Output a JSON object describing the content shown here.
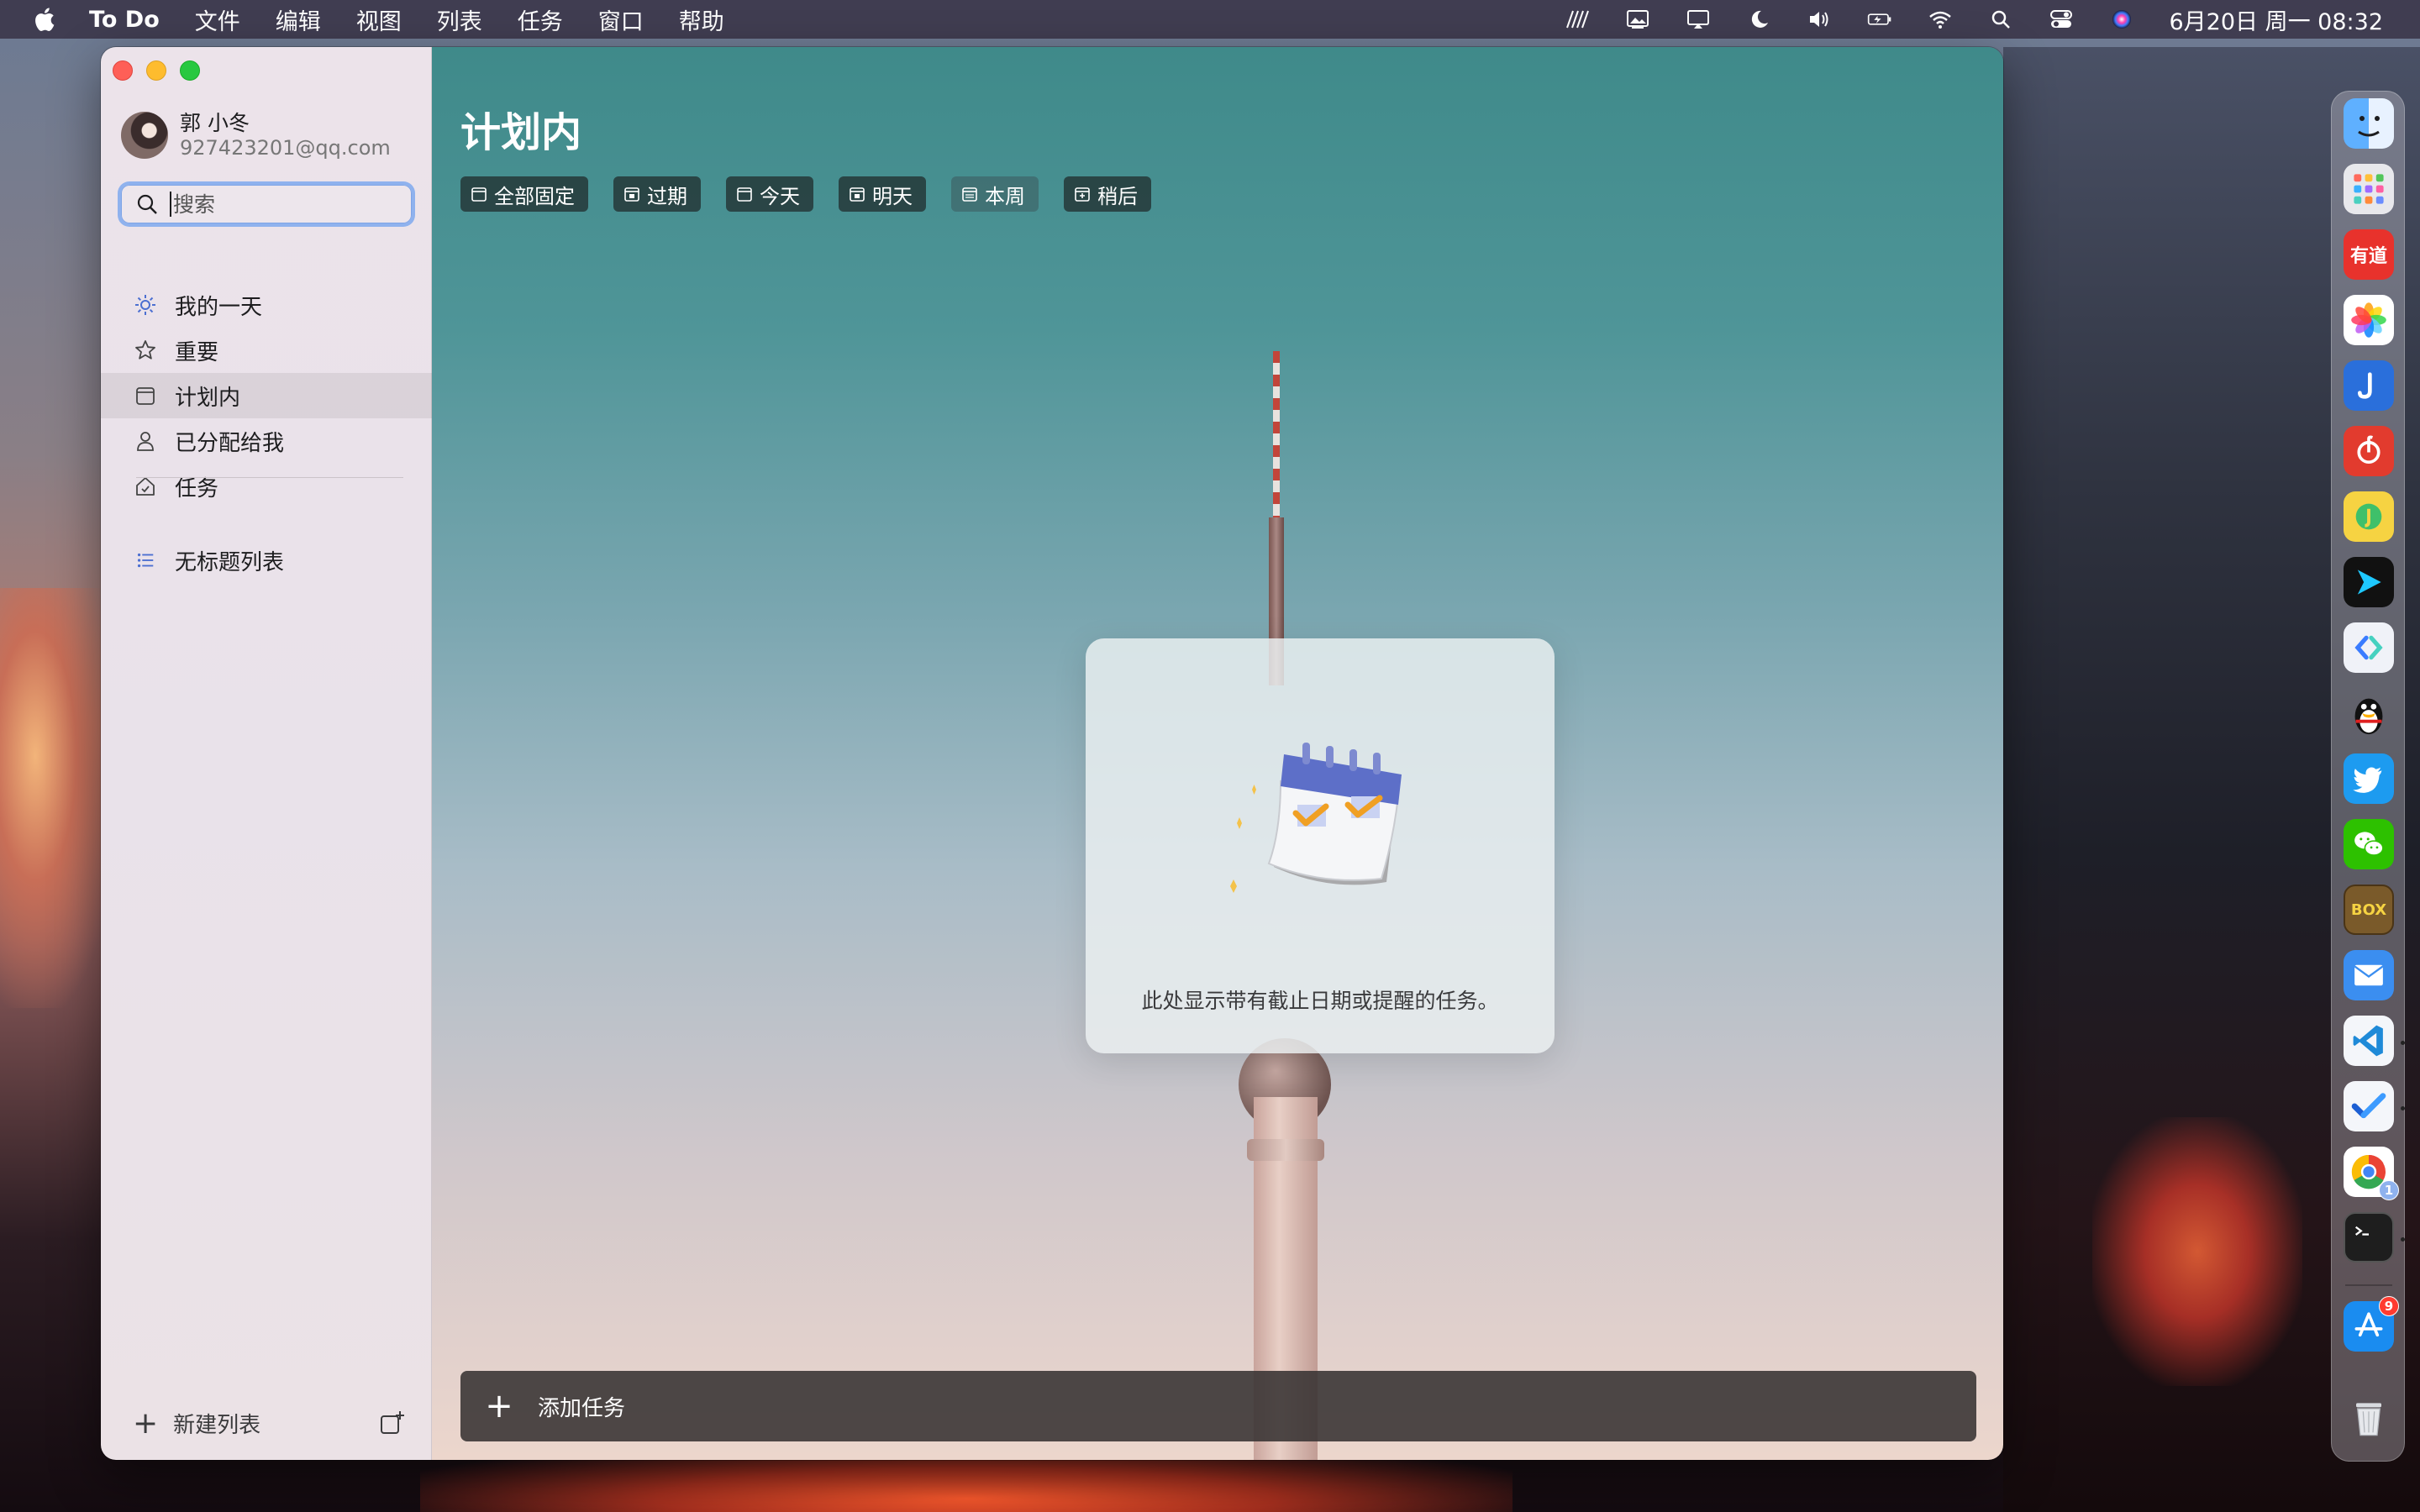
{
  "menubar": {
    "app_name": "To Do",
    "menus": [
      "文件",
      "编辑",
      "视图",
      "列表",
      "任务",
      "窗口",
      "帮助"
    ],
    "clock": "6月20日 周一  08:32",
    "status_icons": [
      "stripe-icon",
      "picture-icon",
      "airplay-icon",
      "moon-icon",
      "volume-icon",
      "battery-icon",
      "wifi-icon",
      "search-icon",
      "control-center-icon",
      "siri-icon"
    ]
  },
  "sidebar": {
    "profile": {
      "name": "郭 小冬",
      "email": "927423201@qq.com"
    },
    "search": {
      "placeholder": "搜索",
      "value": ""
    },
    "nav_items": [
      {
        "label": "我的一天",
        "icon": "sun-icon"
      },
      {
        "label": "重要",
        "icon": "star-icon"
      },
      {
        "label": "计划内",
        "icon": "calendar-icon",
        "active": true
      },
      {
        "label": "已分配给我",
        "icon": "person-icon"
      },
      {
        "label": "任务",
        "icon": "home-icon"
      }
    ],
    "lists": [
      {
        "label": "无标题列表",
        "icon": "list-icon"
      }
    ],
    "new_list_label": "新建列表"
  },
  "main": {
    "title": "计划内",
    "filters": [
      {
        "label": "全部固定"
      },
      {
        "label": "过期"
      },
      {
        "label": "今天"
      },
      {
        "label": "明天"
      },
      {
        "label": "本周"
      },
      {
        "label": "稍后"
      }
    ],
    "empty_message": "此处显示带有截止日期或提醒的任务。",
    "add_task_label": "添加任务"
  },
  "dock": {
    "apps": [
      {
        "name": "finder",
        "color": "#3d8ef0"
      },
      {
        "name": "launchpad",
        "color": "#e8e8ec"
      },
      {
        "name": "youdao",
        "color": "#e8322c",
        "text": "有道"
      },
      {
        "name": "photos",
        "color": "#ffffff"
      },
      {
        "name": "dingtalk-music",
        "color": "#2a6fdb"
      },
      {
        "name": "netease-music",
        "color": "#e23b2e"
      },
      {
        "name": "qq-music",
        "color": "#f6d342"
      },
      {
        "name": "infuse",
        "color": "#111111"
      },
      {
        "name": "links",
        "color": "#f0f2f8"
      },
      {
        "name": "qq",
        "color": "#ffffff"
      },
      {
        "name": "twitter",
        "color": "#1d9bf0"
      },
      {
        "name": "wechat",
        "color": "#2dc100"
      },
      {
        "name": "dosbox",
        "color": "#7a5a2a",
        "text": "BOX"
      },
      {
        "name": "mail",
        "color": "#3b8ef0"
      },
      {
        "name": "vscode",
        "color": "#f4f6fa"
      },
      {
        "name": "todo",
        "color": "#f4f6fa"
      },
      {
        "name": "chrome",
        "color": "#ffffff",
        "badge": "1"
      },
      {
        "name": "terminal",
        "color": "#1e1e1e"
      },
      {
        "name": "app-store",
        "color": "#1a8cf0",
        "badge": "9"
      },
      {
        "name": "trash",
        "color": "#d8dbe0"
      }
    ]
  }
}
